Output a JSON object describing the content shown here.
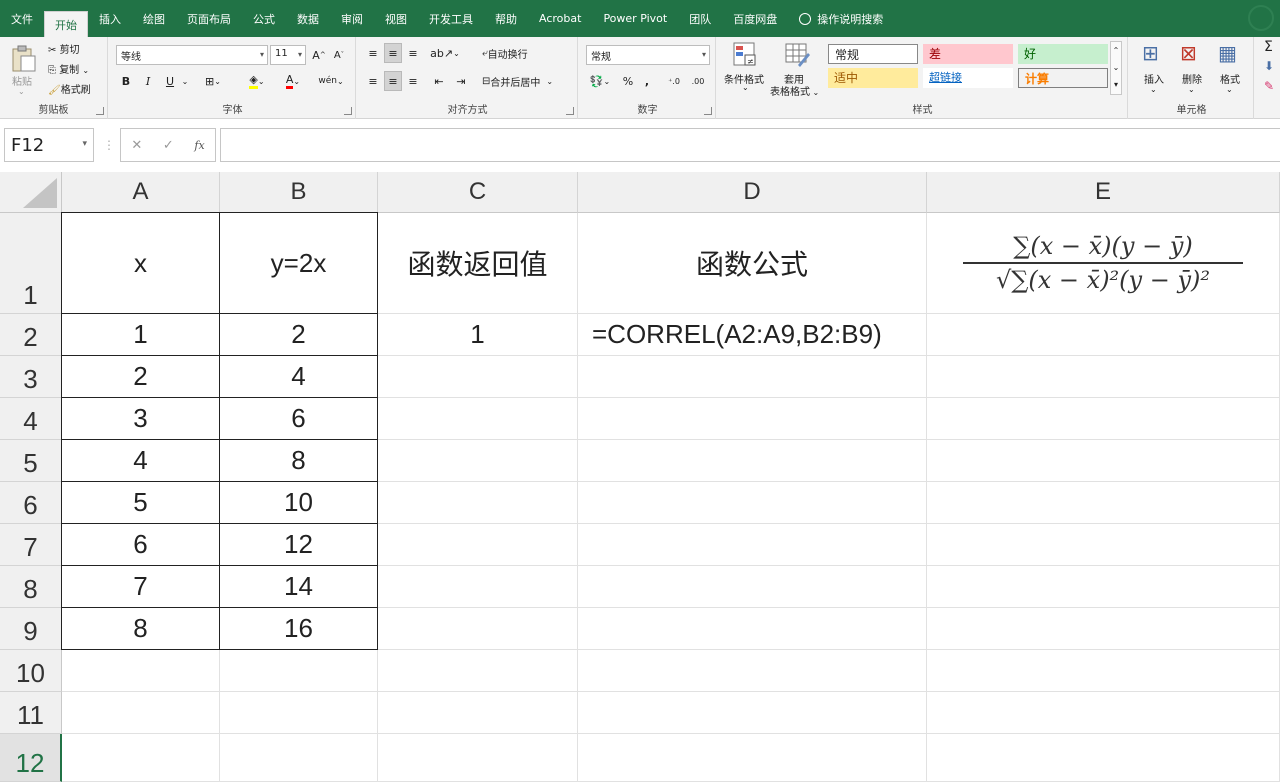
{
  "menu": {
    "tabs": [
      "文件",
      "开始",
      "插入",
      "绘图",
      "页面布局",
      "公式",
      "数据",
      "审阅",
      "视图",
      "开发工具",
      "帮助",
      "Acrobat",
      "Power Pivot",
      "团队",
      "百度网盘"
    ],
    "active_tab": "开始",
    "search": "操作说明搜索"
  },
  "ribbon": {
    "clipboard": {
      "paste": "粘贴",
      "cut": "剪切",
      "copy": "复制",
      "format_painter": "格式刷",
      "label": "剪贴板"
    },
    "font": {
      "name": "等线",
      "size": "11",
      "grow": "A",
      "shrink": "A",
      "bold": "B",
      "italic": "I",
      "underline": "U",
      "phonetic": "wén",
      "label": "字体"
    },
    "alignment": {
      "wrap": "自动换行",
      "merge": "合并后居中",
      "label": "对齐方式"
    },
    "number": {
      "format": "常规",
      "percent": "%",
      "comma": ",",
      "label": "数字"
    },
    "styles": {
      "conditional": "条件格式",
      "table_format_1": "套用",
      "table_format_2": "表格格式",
      "cells": [
        {
          "text": "常规",
          "color": "#222222",
          "bg": "#ffffff"
        },
        {
          "text": "差",
          "color": "#9c0006",
          "bg": "#ffc7ce"
        },
        {
          "text": "好",
          "color": "#006100",
          "bg": "#c6efce"
        },
        {
          "text": "适中",
          "color": "#9c5700",
          "bg": "#ffeb9c"
        },
        {
          "text": "超链接",
          "color": "#0563c1",
          "bg": "#ffffff"
        },
        {
          "text": "计算",
          "color": "#fa7d00",
          "bg": "#f2f2f2"
        }
      ],
      "label": "样式"
    },
    "cells_group": {
      "insert": "插入",
      "delete": "删除",
      "format": "格式",
      "label": "单元格"
    }
  },
  "formula_bar": {
    "name_box": "F12",
    "fx": "fx",
    "formula": ""
  },
  "grid": {
    "columns": [
      "A",
      "B",
      "C",
      "D",
      "E"
    ],
    "rows": [
      "1",
      "2",
      "3",
      "4",
      "5",
      "6",
      "7",
      "8",
      "9",
      "10",
      "11",
      "12"
    ],
    "selected_row": "12",
    "header_row": {
      "a": "x",
      "b": "y=2x",
      "c": "函数返回值",
      "d": "函数公式"
    },
    "formula_image": {
      "numerator": "∑(x − x̄)(y − ȳ)",
      "denominator": "√∑(x − x̄)²(y − ȳ)²"
    },
    "data": [
      {
        "a": "1",
        "b": "2",
        "c": "1",
        "d": "=CORREL(A2:A9,B2:B9)"
      },
      {
        "a": "2",
        "b": "4"
      },
      {
        "a": "3",
        "b": "6"
      },
      {
        "a": "4",
        "b": "8"
      },
      {
        "a": "5",
        "b": "10"
      },
      {
        "a": "6",
        "b": "12"
      },
      {
        "a": "7",
        "b": "14"
      },
      {
        "a": "8",
        "b": "16"
      }
    ]
  }
}
